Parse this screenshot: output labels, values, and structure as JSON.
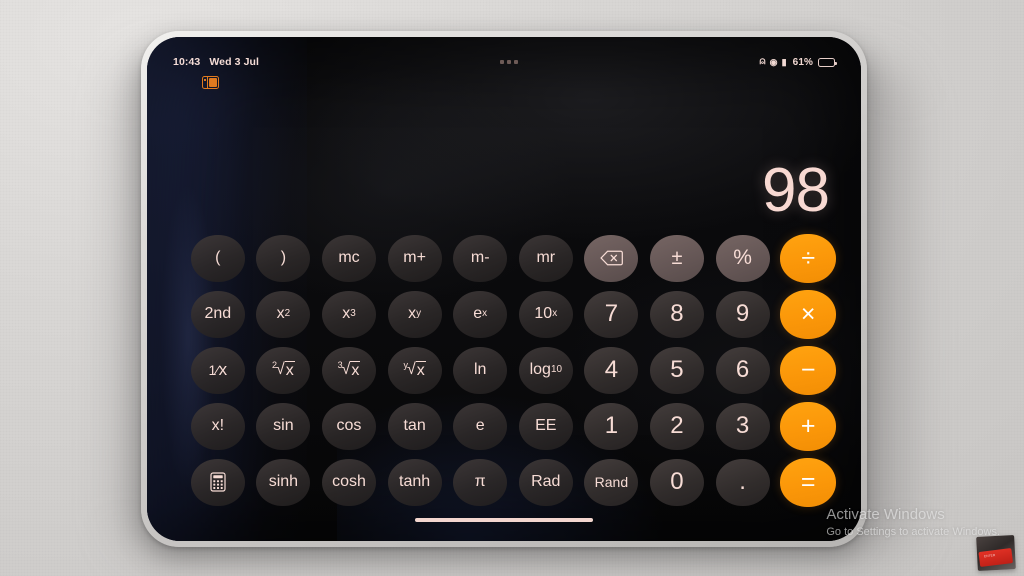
{
  "device": {
    "name": "tablet",
    "bezel_color": "#d8d6d4"
  },
  "status_bar": {
    "time": "10:43",
    "date": "Wed 3 Jul",
    "multitask_handle": "three-dots-handle",
    "wifi_icon": "wifi-icon",
    "lock_icon": "rotation-lock-icon",
    "screen_icon": "screen-record-icon",
    "battery_percent": "61%",
    "battery_level": 61,
    "stage_manager_icon": "split-view-icon",
    "stage_manager_color": "#e07a1f"
  },
  "app": {
    "name": "Calculator",
    "mode": "scientific",
    "display_value": "98",
    "display_color": "#f8d9d2"
  },
  "colors": {
    "operator_orange": "#fb9709",
    "function_gray": "#2e2a2a",
    "number_gray": "#45403f",
    "utility_gray": "#6f5f5e",
    "key_text": "#f7dcd5"
  },
  "keypad": {
    "rows": [
      [
        {
          "label": "(",
          "name": "open-paren",
          "style": "fn"
        },
        {
          "label": ")",
          "name": "close-paren",
          "style": "fn"
        },
        {
          "label": "mc",
          "name": "memory-clear",
          "style": "fn"
        },
        {
          "label": "m+",
          "name": "memory-add",
          "style": "fn"
        },
        {
          "label": "m-",
          "name": "memory-subtract",
          "style": "fn"
        },
        {
          "label": "mr",
          "name": "memory-recall",
          "style": "fn"
        },
        {
          "label": "",
          "name": "backspace",
          "style": "util",
          "icon": "backspace-icon"
        },
        {
          "label": "+/-",
          "name": "sign-toggle",
          "style": "util",
          "glyph": "plus-minus"
        },
        {
          "label": "%",
          "name": "percent",
          "style": "util"
        },
        {
          "label": "÷",
          "name": "divide",
          "style": "op"
        }
      ],
      [
        {
          "label": "2nd",
          "name": "second-function",
          "style": "fn"
        },
        {
          "label": "x2",
          "name": "x-squared",
          "style": "fn",
          "glyph": "x-sup-2"
        },
        {
          "label": "x3",
          "name": "x-cubed",
          "style": "fn",
          "glyph": "x-sup-3"
        },
        {
          "label": "xy",
          "name": "x-power-y",
          "style": "fn",
          "glyph": "x-sup-y"
        },
        {
          "label": "ex",
          "name": "e-power-x",
          "style": "fn",
          "glyph": "e-sup-x"
        },
        {
          "label": "10x",
          "name": "ten-power-x",
          "style": "fn",
          "glyph": "10-sup-x"
        },
        {
          "label": "7",
          "name": "digit-7",
          "style": "num"
        },
        {
          "label": "8",
          "name": "digit-8",
          "style": "num"
        },
        {
          "label": "9",
          "name": "digit-9",
          "style": "num"
        },
        {
          "label": "×",
          "name": "multiply",
          "style": "op"
        }
      ],
      [
        {
          "label": "1/x",
          "name": "reciprocal",
          "style": "fn",
          "glyph": "one-over-x"
        },
        {
          "label": "2√x",
          "name": "square-root",
          "style": "fn",
          "glyph": "root-2"
        },
        {
          "label": "3√x",
          "name": "cube-root",
          "style": "fn",
          "glyph": "root-3"
        },
        {
          "label": "y√x",
          "name": "y-root-x",
          "style": "fn",
          "glyph": "root-y"
        },
        {
          "label": "ln",
          "name": "natural-log",
          "style": "fn"
        },
        {
          "label": "log10",
          "name": "log-base-10",
          "style": "fn",
          "glyph": "log-sub-10"
        },
        {
          "label": "4",
          "name": "digit-4",
          "style": "num"
        },
        {
          "label": "5",
          "name": "digit-5",
          "style": "num"
        },
        {
          "label": "6",
          "name": "digit-6",
          "style": "num"
        },
        {
          "label": "−",
          "name": "subtract",
          "style": "op"
        }
      ],
      [
        {
          "label": "x!",
          "name": "factorial",
          "style": "fn"
        },
        {
          "label": "sin",
          "name": "sine",
          "style": "fn"
        },
        {
          "label": "cos",
          "name": "cosine",
          "style": "fn"
        },
        {
          "label": "tan",
          "name": "tangent",
          "style": "fn"
        },
        {
          "label": "e",
          "name": "euler-constant",
          "style": "fn"
        },
        {
          "label": "EE",
          "name": "exponent-entry",
          "style": "fn"
        },
        {
          "label": "1",
          "name": "digit-1",
          "style": "num"
        },
        {
          "label": "2",
          "name": "digit-2",
          "style": "num"
        },
        {
          "label": "3",
          "name": "digit-3",
          "style": "num"
        },
        {
          "label": "+",
          "name": "add",
          "style": "op"
        }
      ],
      [
        {
          "label": "",
          "name": "calculator-mode",
          "style": "fn",
          "icon": "calculator-icon"
        },
        {
          "label": "sinh",
          "name": "hyperbolic-sine",
          "style": "fn"
        },
        {
          "label": "cosh",
          "name": "hyperbolic-cosine",
          "style": "fn"
        },
        {
          "label": "tanh",
          "name": "hyperbolic-tangent",
          "style": "fn"
        },
        {
          "label": "π",
          "name": "pi-constant",
          "style": "fn"
        },
        {
          "label": "Rad",
          "name": "radian-toggle",
          "style": "fn"
        },
        {
          "label": "Rand",
          "name": "random-number",
          "style": "num",
          "small": true
        },
        {
          "label": "0",
          "name": "digit-0",
          "style": "num"
        },
        {
          "label": ".",
          "name": "decimal-point",
          "style": "num"
        },
        {
          "label": "=",
          "name": "equals",
          "style": "op"
        }
      ]
    ]
  },
  "home_indicator": "home-indicator-bar",
  "watermark": {
    "title": "Activate Windows",
    "subtitle": "Go to Settings to activate Windows."
  },
  "desk_object": {
    "name": "red-keyboard-key",
    "text": "ENTER"
  }
}
